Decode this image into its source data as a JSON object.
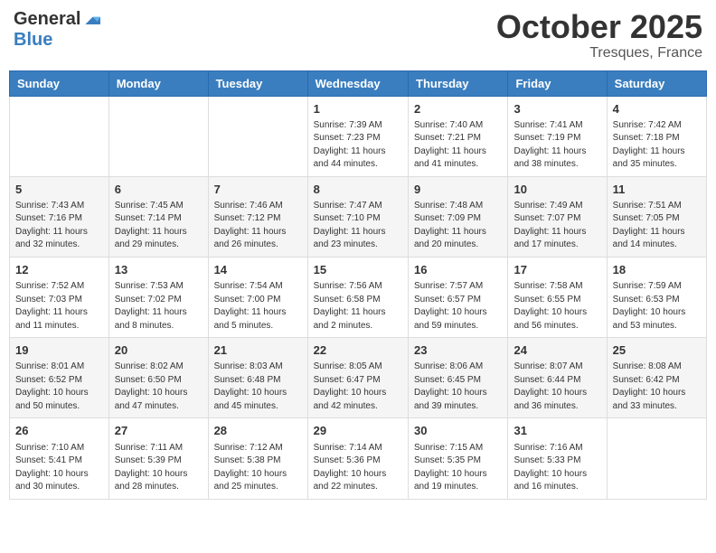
{
  "header": {
    "logo_general": "General",
    "logo_blue": "Blue",
    "month": "October 2025",
    "location": "Tresques, France"
  },
  "days_of_week": [
    "Sunday",
    "Monday",
    "Tuesday",
    "Wednesday",
    "Thursday",
    "Friday",
    "Saturday"
  ],
  "weeks": [
    [
      null,
      null,
      null,
      {
        "day": 1,
        "sunrise": "7:39 AM",
        "sunset": "7:23 PM",
        "daylight": "11 hours and 44 minutes."
      },
      {
        "day": 2,
        "sunrise": "7:40 AM",
        "sunset": "7:21 PM",
        "daylight": "11 hours and 41 minutes."
      },
      {
        "day": 3,
        "sunrise": "7:41 AM",
        "sunset": "7:19 PM",
        "daylight": "11 hours and 38 minutes."
      },
      {
        "day": 4,
        "sunrise": "7:42 AM",
        "sunset": "7:18 PM",
        "daylight": "11 hours and 35 minutes."
      }
    ],
    [
      {
        "day": 5,
        "sunrise": "7:43 AM",
        "sunset": "7:16 PM",
        "daylight": "11 hours and 32 minutes."
      },
      {
        "day": 6,
        "sunrise": "7:45 AM",
        "sunset": "7:14 PM",
        "daylight": "11 hours and 29 minutes."
      },
      {
        "day": 7,
        "sunrise": "7:46 AM",
        "sunset": "7:12 PM",
        "daylight": "11 hours and 26 minutes."
      },
      {
        "day": 8,
        "sunrise": "7:47 AM",
        "sunset": "7:10 PM",
        "daylight": "11 hours and 23 minutes."
      },
      {
        "day": 9,
        "sunrise": "7:48 AM",
        "sunset": "7:09 PM",
        "daylight": "11 hours and 20 minutes."
      },
      {
        "day": 10,
        "sunrise": "7:49 AM",
        "sunset": "7:07 PM",
        "daylight": "11 hours and 17 minutes."
      },
      {
        "day": 11,
        "sunrise": "7:51 AM",
        "sunset": "7:05 PM",
        "daylight": "11 hours and 14 minutes."
      }
    ],
    [
      {
        "day": 12,
        "sunrise": "7:52 AM",
        "sunset": "7:03 PM",
        "daylight": "11 hours and 11 minutes."
      },
      {
        "day": 13,
        "sunrise": "7:53 AM",
        "sunset": "7:02 PM",
        "daylight": "11 hours and 8 minutes."
      },
      {
        "day": 14,
        "sunrise": "7:54 AM",
        "sunset": "7:00 PM",
        "daylight": "11 hours and 5 minutes."
      },
      {
        "day": 15,
        "sunrise": "7:56 AM",
        "sunset": "6:58 PM",
        "daylight": "11 hours and 2 minutes."
      },
      {
        "day": 16,
        "sunrise": "7:57 AM",
        "sunset": "6:57 PM",
        "daylight": "10 hours and 59 minutes."
      },
      {
        "day": 17,
        "sunrise": "7:58 AM",
        "sunset": "6:55 PM",
        "daylight": "10 hours and 56 minutes."
      },
      {
        "day": 18,
        "sunrise": "7:59 AM",
        "sunset": "6:53 PM",
        "daylight": "10 hours and 53 minutes."
      }
    ],
    [
      {
        "day": 19,
        "sunrise": "8:01 AM",
        "sunset": "6:52 PM",
        "daylight": "10 hours and 50 minutes."
      },
      {
        "day": 20,
        "sunrise": "8:02 AM",
        "sunset": "6:50 PM",
        "daylight": "10 hours and 47 minutes."
      },
      {
        "day": 21,
        "sunrise": "8:03 AM",
        "sunset": "6:48 PM",
        "daylight": "10 hours and 45 minutes."
      },
      {
        "day": 22,
        "sunrise": "8:05 AM",
        "sunset": "6:47 PM",
        "daylight": "10 hours and 42 minutes."
      },
      {
        "day": 23,
        "sunrise": "8:06 AM",
        "sunset": "6:45 PM",
        "daylight": "10 hours and 39 minutes."
      },
      {
        "day": 24,
        "sunrise": "8:07 AM",
        "sunset": "6:44 PM",
        "daylight": "10 hours and 36 minutes."
      },
      {
        "day": 25,
        "sunrise": "8:08 AM",
        "sunset": "6:42 PM",
        "daylight": "10 hours and 33 minutes."
      }
    ],
    [
      {
        "day": 26,
        "sunrise": "7:10 AM",
        "sunset": "5:41 PM",
        "daylight": "10 hours and 30 minutes."
      },
      {
        "day": 27,
        "sunrise": "7:11 AM",
        "sunset": "5:39 PM",
        "daylight": "10 hours and 28 minutes."
      },
      {
        "day": 28,
        "sunrise": "7:12 AM",
        "sunset": "5:38 PM",
        "daylight": "10 hours and 25 minutes."
      },
      {
        "day": 29,
        "sunrise": "7:14 AM",
        "sunset": "5:36 PM",
        "daylight": "10 hours and 22 minutes."
      },
      {
        "day": 30,
        "sunrise": "7:15 AM",
        "sunset": "5:35 PM",
        "daylight": "10 hours and 19 minutes."
      },
      {
        "day": 31,
        "sunrise": "7:16 AM",
        "sunset": "5:33 PM",
        "daylight": "10 hours and 16 minutes."
      },
      null
    ]
  ]
}
